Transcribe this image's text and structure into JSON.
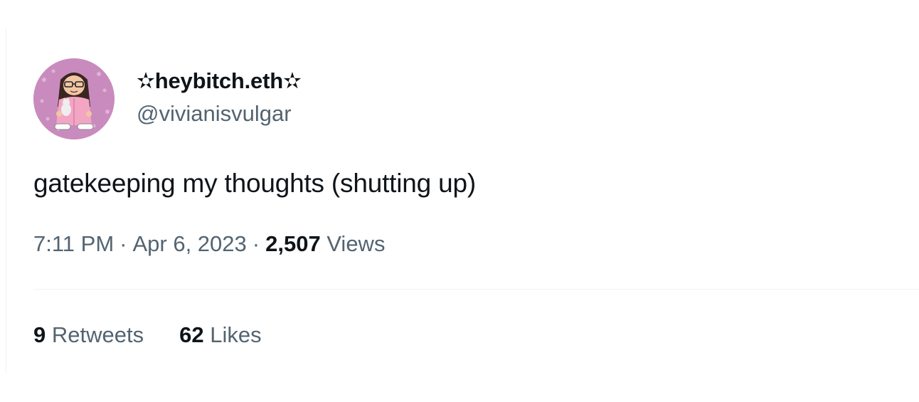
{
  "tweet": {
    "author": {
      "display_name": "✫heybitch.eth✫",
      "handle": "@vivianisvulgar",
      "avatar_icon": "cartoon-avatar-icon"
    },
    "text": "gatekeeping my thoughts (shutting up)",
    "time": "7:11 PM",
    "separator": "·",
    "date": "Apr 6, 2023",
    "views_count": "2,507",
    "views_label": "Views",
    "retweets_count": "9",
    "retweets_label": "Retweets",
    "likes_count": "62",
    "likes_label": "Likes"
  },
  "colors": {
    "text_primary": "#0f1419",
    "text_secondary": "#536471",
    "divider": "#eff3f4",
    "avatar_background": "#c98bbd"
  }
}
